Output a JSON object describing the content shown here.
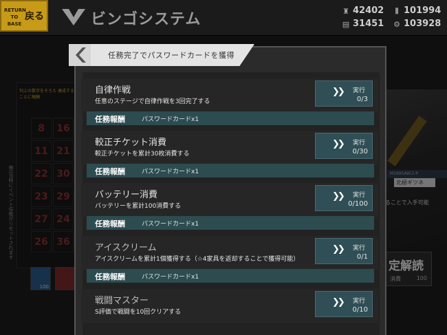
{
  "topbar": {
    "return_small": "RETURN TO BASE",
    "return_label": "戻る",
    "title": "ビンゴシステム",
    "resources": [
      {
        "icon": "manpower-icon",
        "value": "42402"
      },
      {
        "icon": "ammo-icon",
        "value": "101994"
      },
      {
        "icon": "ration-icon",
        "value": "31451"
      },
      {
        "icon": "parts-icon",
        "value": "103928"
      }
    ]
  },
  "background": {
    "description": "列上の数字をそろえ 達成することに報酬",
    "grid_numbers": [
      "8",
      "16",
      "11",
      "21",
      "22",
      "30",
      "23",
      "29",
      "27",
      "24",
      "26",
      "36"
    ],
    "side_note": "毎日0時にイベント任務がリセットされます",
    "card_count": "100",
    "tag1": "M1895AWスキ",
    "tag2": "北極ギツネ",
    "tag3": "ることで入手可能",
    "confirm_title": "定解読",
    "confirm_sub": "消費",
    "confirm_num": "100"
  },
  "dialog": {
    "title": "任務完了でパスワードカードを獲得",
    "go_label": "実行",
    "reward_label": "任務報酬",
    "missions": [
      {
        "name": "自律作戦",
        "desc": "任意のステージで自律作戦を3回完了する",
        "progress": "0/3",
        "reward": "パスワードカードx1"
      },
      {
        "name": "較正チケット消費",
        "desc": "較正チケットを累計30枚消費する",
        "progress": "0/30",
        "reward": "パスワードカードx1"
      },
      {
        "name": "バッテリー消費",
        "desc": "バッテリーを累計100消費する",
        "progress": "0/100",
        "reward": "パスワードカードx1"
      },
      {
        "name": "アイスクリーム",
        "desc": "アイスクリームを累計1個獲得する（☆4家具を返却することで獲得可能）",
        "progress": "0/1",
        "reward": "パスワードカードx1"
      },
      {
        "name": "戦闘マスター",
        "desc": "S評価で戦闘を10回クリアする",
        "progress": "0/10",
        "reward": ""
      }
    ]
  }
}
